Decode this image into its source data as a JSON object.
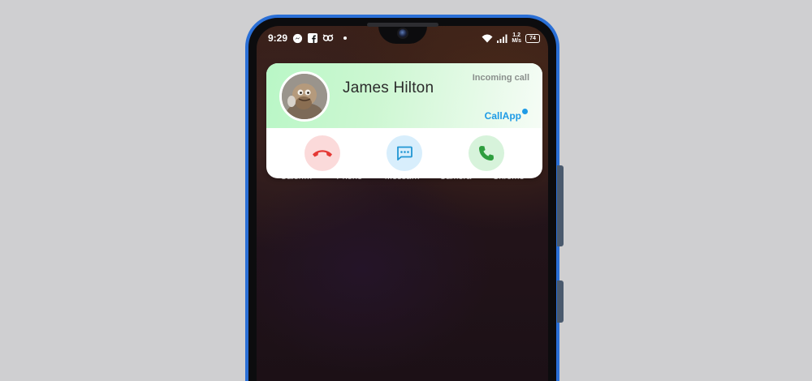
{
  "status_bar": {
    "time": "9:29",
    "network_speed_value": "1.2",
    "network_speed_unit": "M/s",
    "battery_level": "74"
  },
  "home_apps": {
    "labels": [
      "Calen…",
      "Phone",
      "Messa…",
      "Camera",
      "Chrome"
    ]
  },
  "incoming_call": {
    "caller_name": "James Hilton",
    "status_text": "Incoming call",
    "brand": "CallApp",
    "actions": {
      "decline": "decline-call",
      "message": "reply-message",
      "answer": "answer-call"
    }
  },
  "colors": {
    "phone_frame": "#2a6fd6",
    "decline": "#e53935",
    "message": "#2196d3",
    "answer": "#2e9e3e",
    "brand": "#1e9be6"
  }
}
